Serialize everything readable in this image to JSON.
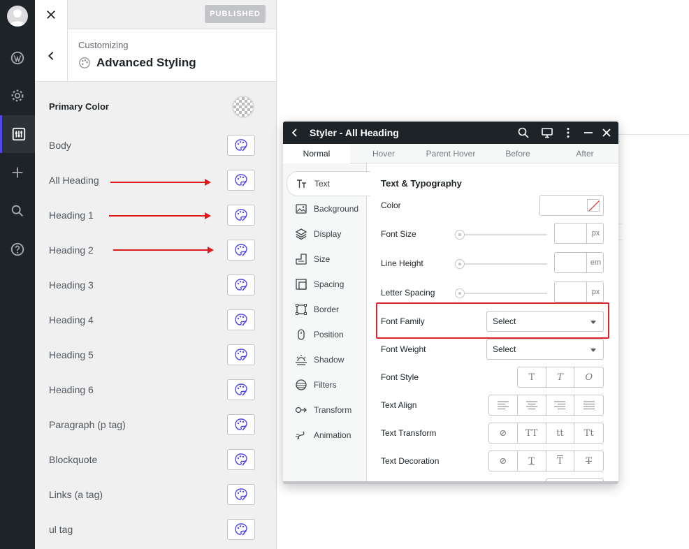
{
  "header": {
    "published_label": "PUBLISHED",
    "subtitle": "Customizing",
    "title": "Advanced Styling"
  },
  "primary_color": {
    "label": "Primary Color"
  },
  "rows": [
    {
      "label": "Body"
    },
    {
      "label": "All Heading"
    },
    {
      "label": "Heading 1"
    },
    {
      "label": "Heading 2"
    },
    {
      "label": "Heading 3"
    },
    {
      "label": "Heading 4"
    },
    {
      "label": "Heading 5"
    },
    {
      "label": "Heading 6"
    },
    {
      "label": "Paragraph (p tag)"
    },
    {
      "label": "Blockquote"
    },
    {
      "label": "Links (a tag)"
    },
    {
      "label": "ul tag"
    }
  ],
  "styler": {
    "title": "Styler - All Heading",
    "tabs": [
      "Normal",
      "Hover",
      "Parent Hover",
      "Before",
      "After"
    ],
    "sidebar": [
      "Text",
      "Background",
      "Display",
      "Size",
      "Spacing",
      "Border",
      "Position",
      "Shadow",
      "Filters",
      "Transform",
      "Animation"
    ],
    "section_title": "Text & Typography",
    "fields": {
      "color": "Color",
      "font_size": "Font Size",
      "font_size_unit": "px",
      "line_height": "Line Height",
      "line_height_unit": "em",
      "letter_spacing": "Letter Spacing",
      "letter_spacing_unit": "px",
      "font_family": "Font Family",
      "font_family_value": "Select",
      "font_weight": "Font Weight",
      "font_weight_value": "Select",
      "font_style": "Font Style",
      "font_style_options": [
        "T",
        "T",
        "O"
      ],
      "text_align": "Text Align",
      "text_transform": "Text Transform",
      "text_transform_options": [
        "⊘",
        "TT",
        "tt",
        "Tt"
      ],
      "text_decoration": "Text Decoration",
      "text_decoration_options": [
        "⊘",
        "T",
        "T",
        "T"
      ]
    }
  },
  "colors": {
    "admin_bar": "#1d2327",
    "accent": "#4f46e5",
    "annotation": "#e0191a"
  }
}
